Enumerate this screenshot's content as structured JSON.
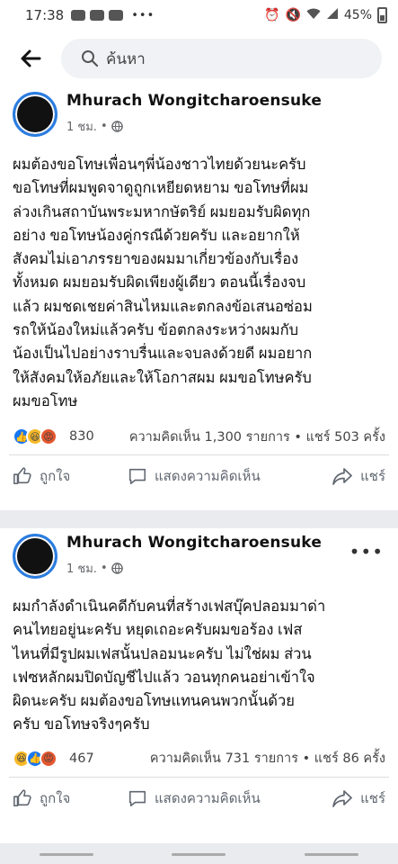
{
  "status_bar": {
    "time": "17:38",
    "battery": "45%"
  },
  "search": {
    "placeholder": "ค้นหา"
  },
  "posts": [
    {
      "author": "Mhurach Wongitcharoensuke",
      "time": "1 ชม.",
      "text": "ผมต้องขอโทษเพื่อนๆพี่น้องชาวไทยด้วยนะครับ\nขอโทษที่ผมพูดจาดูถูกเหยียดหยาม ขอโทษที่ผม\nล่วงเกินสถาบันพระมหากษัตริย์ ผมยอมรับผิดทุก\nอย่าง ขอโทษน้องคู่กรณีด้วยครับ และอยากให้\nสังคมไม่เอาภรรยาของผมมาเกี่ยวข้องกับเรื่อง\nทั้งหมด ผมยอมรับผิดเพียงผู้เดียว ตอนนี้เรื่องจบ\nแล้ว ผมชดเชยค่าสินไหมและตกลงข้อเสนอซ่อม\nรถให้น้องใหม่แล้วครับ ข้อตกลงระหว่างผมกับ\nน้องเป็นไปอย่างราบรื่นและจบลงด้วยดี ผมอยาก\nให้สังคมให้อภัยและให้โอกาสผม ผมขอโทษครับ\nผมขอโทษ",
      "reaction_count": "830",
      "comments": "ความคิดเห็น 1,300 รายการ",
      "shares": "แชร์ 503 ครั้ง",
      "like_label": "ถูกใจ",
      "comment_label": "แสดงความคิดเห็น",
      "share_label": "แชร์"
    },
    {
      "author": "Mhurach Wongitcharoensuke",
      "time": "1 ชม.",
      "text": "ผมกำลังดำเนินคดีกับคนที่สร้างเฟสบุ๊คปลอมมาด่า\nคนไทยอยู่นะครับ หยุดเถอะครับผมขอร้อง เฟส\nไหนที่มีรูปผมเฟสนั้นปลอมนะครับ ไม่ใช่ผม ส่วน\nเฟซหลักผมปิดบัญชีไปแล้ว วอนทุกคนอย่าเข้าใจ\nผิดนะครับ ผมต้องขอโทษแทนคนพวกนั้นด้วย\nครับ ขอโทษจริงๆครับ",
      "reaction_count": "467",
      "comments": "ความคิดเห็น 731 รายการ",
      "shares": "แชร์ 86 ครั้ง",
      "like_label": "ถูกใจ",
      "comment_label": "แสดงความคิดเห็น",
      "share_label": "แชร์"
    }
  ]
}
